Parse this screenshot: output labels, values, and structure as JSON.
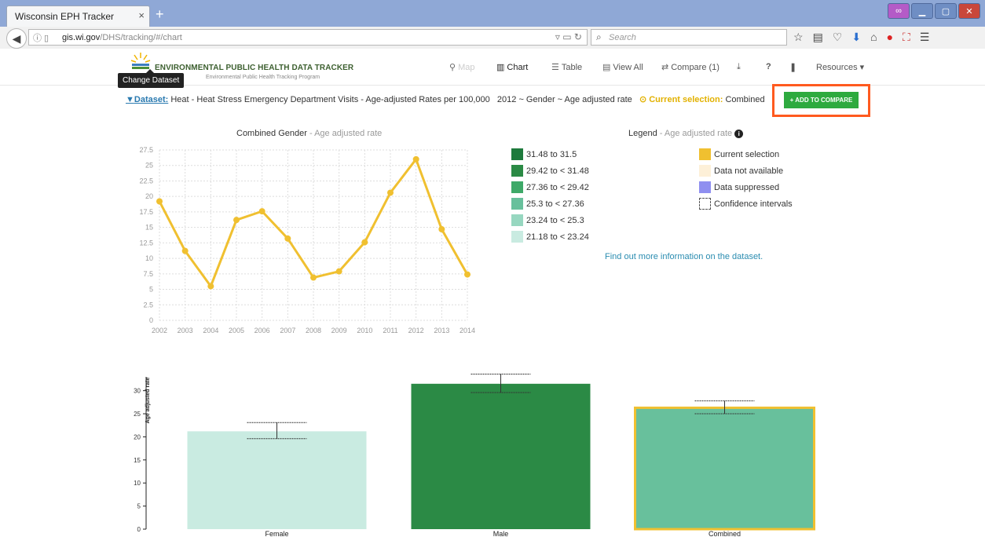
{
  "browser": {
    "tab_title": "Wisconsin EPH Tracker",
    "tab_close": "×",
    "new_tab": "+",
    "url_host": "gis.wi.gov",
    "url_path": "/DHS/tracking/#/chart",
    "search_placeholder": "Search"
  },
  "header": {
    "logo_title": "ENVIRONMENTAL PUBLIC HEALTH DATA TRACKER",
    "logo_subtitle": "Environmental Public Health Tracking Program",
    "tooltip": "Change Dataset",
    "nav": {
      "map": "Map",
      "chart": "Chart",
      "table": "Table",
      "view_all": "View All",
      "compare": "Compare (1)",
      "help": "?",
      "resources": "Resources"
    }
  },
  "dataset": {
    "label": "Dataset:",
    "name": "Heat - Heat Stress Emergency Department Visits - Age-adjusted Rates per 100,000",
    "filters": "2012 ~ Gender ~ Age adjusted rate",
    "current_label": "Current selection:",
    "current_value": "Combined",
    "add_button": "+ ADD TO COMPARE"
  },
  "line_chart": {
    "title": "Combined Gender",
    "subtitle": "- Age adjusted rate"
  },
  "legend": {
    "title": "Legend",
    "subtitle": "- Age adjusted rate",
    "classes": [
      {
        "label": "31.48 to 31.5",
        "color": "#1e7a3c"
      },
      {
        "label": "29.42 to < 31.48",
        "color": "#2b8a45"
      },
      {
        "label": "27.36 to < 29.42",
        "color": "#3ea968"
      },
      {
        "label": "25.3 to < 27.36",
        "color": "#68c09c"
      },
      {
        "label": "23.24 to < 25.3",
        "color": "#97d7c0"
      },
      {
        "label": "21.18 to < 23.24",
        "color": "#c9ebe1"
      }
    ],
    "items": [
      {
        "label": "Current selection",
        "color": "#f0c030"
      },
      {
        "label": "Data not available",
        "color": "#fdf0d8"
      },
      {
        "label": "Data suppressed",
        "color": "#8f8ff0"
      },
      {
        "label": "Confidence intervals",
        "color": "#ffffff"
      }
    ],
    "link": "Find out more information on the dataset."
  },
  "chart_data": [
    {
      "type": "line",
      "title": "",
      "x": [
        "2002",
        "2003",
        "2004",
        "2005",
        "2006",
        "2007",
        "2008",
        "2009",
        "2010",
        "2011",
        "2012",
        "2013",
        "2014"
      ],
      "series": [
        {
          "values": [
            19.2,
            11.2,
            5.5,
            16.2,
            17.6,
            13.2,
            6.9,
            7.9,
            12.6,
            20.6,
            26.0,
            14.7,
            7.4
          ]
        }
      ],
      "y_ticks": [
        "0",
        "2.5",
        "5",
        "7.5",
        "10",
        "12.5",
        "15",
        "17.5",
        "20",
        "22.5",
        "25",
        "27.5"
      ],
      "ylim": [
        0,
        27.5
      ],
      "grid": true,
      "color": "#f0c030"
    },
    {
      "type": "bar",
      "categories": [
        "Female",
        "Male",
        "Combined"
      ],
      "values": [
        21.2,
        31.5,
        26.3
      ],
      "ci_low": [
        19.6,
        29.6,
        25.0
      ],
      "ci_high": [
        23.1,
        33.6,
        27.8
      ],
      "colors": [
        "#c9ebe1",
        "#2b8a45",
        "#68c09c"
      ],
      "highlight": "Combined",
      "ylabel": "Age adjusted rate",
      "y_ticks": [
        "0",
        "5",
        "10",
        "15",
        "20",
        "25",
        "30"
      ],
      "ylim": [
        0,
        33
      ]
    }
  ]
}
